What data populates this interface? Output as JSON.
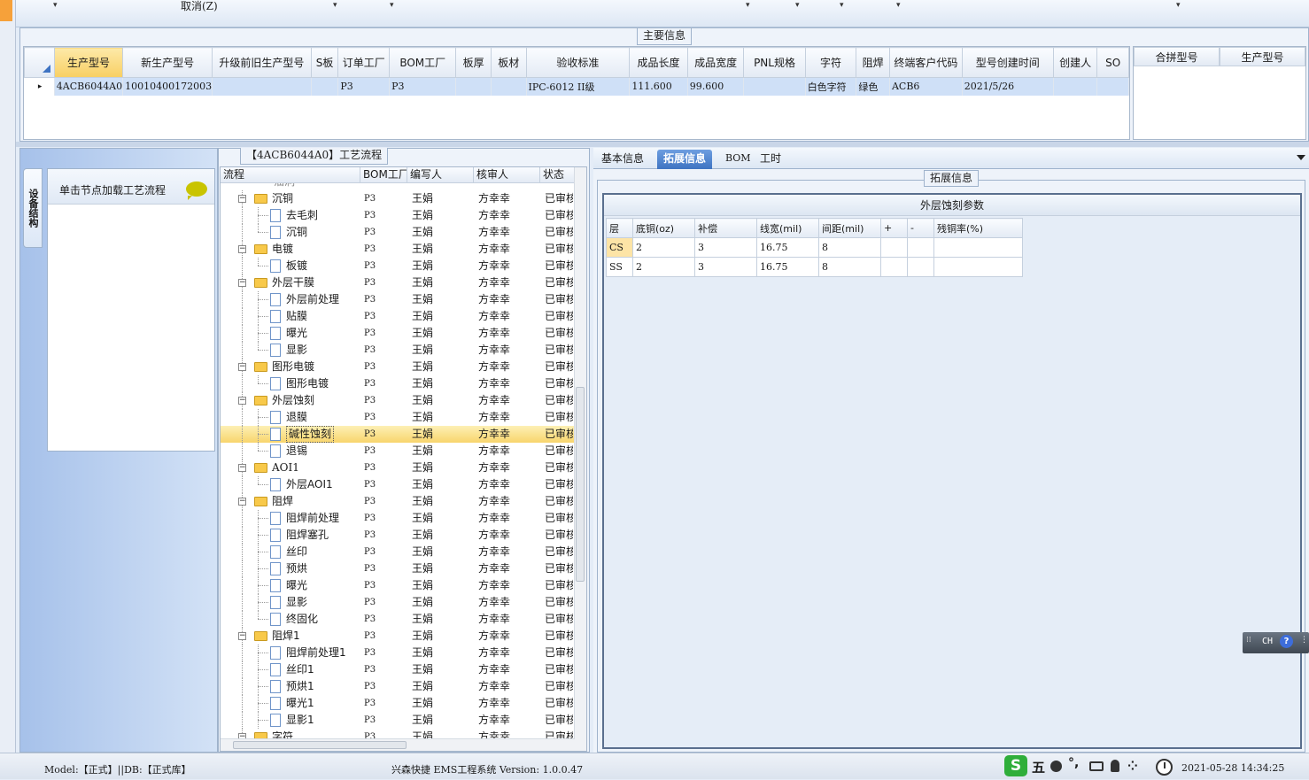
{
  "toolbar": {
    "cancel_label": "取消(Z)",
    "dropdown_glyph": "▾"
  },
  "main_info": {
    "title": "主要信息",
    "columns": [
      "生产型号",
      "新生产型号",
      "升级前旧生产型号",
      "S板",
      "订单工厂",
      "BOM工厂",
      "板厚",
      "板材",
      "验收标准",
      "成品长度",
      "成品宽度",
      "PNL规格",
      "字符",
      "阻焊",
      "终端客户代码",
      "型号创建时间",
      "创建人",
      "SO"
    ],
    "row": [
      "4ACB6044A0",
      "10010400172003",
      "",
      "",
      "P3",
      "P3",
      "",
      "",
      "IPC-6012 II级",
      "111.600",
      "99.600",
      "",
      "白色字符",
      "绿色",
      "ACB6",
      "2021/5/26",
      "",
      ""
    ],
    "row_indicator": "▸",
    "merge_columns": [
      "合拼型号",
      "生产型号"
    ]
  },
  "left_nav": {
    "vertical_tab": "设备结构",
    "panel_title": "单击节点加载工艺流程"
  },
  "flow": {
    "title": "【4ACB6044A0】工艺流程",
    "columns": [
      "流程",
      "BOM工厂",
      "编写人",
      "核审人",
      "状态"
    ],
    "top_partial": "油洞",
    "rows": [
      {
        "level": 0,
        "label": "沉铜",
        "bom": "P3",
        "writer": "王娟",
        "reviewer": "方幸幸",
        "status": "已审核",
        "open": true
      },
      {
        "level": 1,
        "label": "去毛刺",
        "bom": "P3",
        "writer": "王娟",
        "reviewer": "方幸幸",
        "status": "已审核"
      },
      {
        "level": 1,
        "label": "沉铜",
        "bom": "P3",
        "writer": "王娟",
        "reviewer": "方幸幸",
        "status": "已审核",
        "last": true
      },
      {
        "level": 0,
        "label": "电镀",
        "bom": "P3",
        "writer": "王娟",
        "reviewer": "方幸幸",
        "status": "已审核",
        "open": true
      },
      {
        "level": 1,
        "label": "板镀",
        "bom": "P3",
        "writer": "王娟",
        "reviewer": "方幸幸",
        "status": "已审核",
        "last": true
      },
      {
        "level": 0,
        "label": "外层干膜",
        "bom": "P3",
        "writer": "王娟",
        "reviewer": "方幸幸",
        "status": "已审核",
        "open": true
      },
      {
        "level": 1,
        "label": "外层前处理",
        "bom": "P3",
        "writer": "王娟",
        "reviewer": "方幸幸",
        "status": "已审核"
      },
      {
        "level": 1,
        "label": "贴膜",
        "bom": "P3",
        "writer": "王娟",
        "reviewer": "方幸幸",
        "status": "已审核"
      },
      {
        "level": 1,
        "label": "曝光",
        "bom": "P3",
        "writer": "王娟",
        "reviewer": "方幸幸",
        "status": "已审核"
      },
      {
        "level": 1,
        "label": "显影",
        "bom": "P3",
        "writer": "王娟",
        "reviewer": "方幸幸",
        "status": "已审核",
        "last": true
      },
      {
        "level": 0,
        "label": "图形电镀",
        "bom": "P3",
        "writer": "王娟",
        "reviewer": "方幸幸",
        "status": "已审核",
        "open": true
      },
      {
        "level": 1,
        "label": "图形电镀",
        "bom": "P3",
        "writer": "王娟",
        "reviewer": "方幸幸",
        "status": "已审核",
        "last": true
      },
      {
        "level": 0,
        "label": "外层蚀刻",
        "bom": "P3",
        "writer": "王娟",
        "reviewer": "方幸幸",
        "status": "已审核",
        "open": true
      },
      {
        "level": 1,
        "label": "退膜",
        "bom": "P3",
        "writer": "王娟",
        "reviewer": "方幸幸",
        "status": "已审核"
      },
      {
        "level": 1,
        "label": "碱性蚀刻",
        "bom": "P3",
        "writer": "王娟",
        "reviewer": "方幸幸",
        "status": "已审核",
        "selected": true
      },
      {
        "level": 1,
        "label": "退锡",
        "bom": "P3",
        "writer": "王娟",
        "reviewer": "方幸幸",
        "status": "已审核",
        "last": true
      },
      {
        "level": 0,
        "label": "AOI1",
        "bom": "P3",
        "writer": "王娟",
        "reviewer": "方幸幸",
        "status": "已审核",
        "open": true
      },
      {
        "level": 1,
        "label": "外层AOI1",
        "bom": "P3",
        "writer": "王娟",
        "reviewer": "方幸幸",
        "status": "已审核",
        "last": true
      },
      {
        "level": 0,
        "label": "阻焊",
        "bom": "P3",
        "writer": "王娟",
        "reviewer": "方幸幸",
        "status": "已审核",
        "open": true
      },
      {
        "level": 1,
        "label": "阻焊前处理",
        "bom": "P3",
        "writer": "王娟",
        "reviewer": "方幸幸",
        "status": "已审核"
      },
      {
        "level": 1,
        "label": "阻焊塞孔",
        "bom": "P3",
        "writer": "王娟",
        "reviewer": "方幸幸",
        "status": "已审核"
      },
      {
        "level": 1,
        "label": "丝印",
        "bom": "P3",
        "writer": "王娟",
        "reviewer": "方幸幸",
        "status": "已审核"
      },
      {
        "level": 1,
        "label": "预烘",
        "bom": "P3",
        "writer": "王娟",
        "reviewer": "方幸幸",
        "status": "已审核"
      },
      {
        "level": 1,
        "label": "曝光",
        "bom": "P3",
        "writer": "王娟",
        "reviewer": "方幸幸",
        "status": "已审核"
      },
      {
        "level": 1,
        "label": "显影",
        "bom": "P3",
        "writer": "王娟",
        "reviewer": "方幸幸",
        "status": "已审核"
      },
      {
        "level": 1,
        "label": "终固化",
        "bom": "P3",
        "writer": "王娟",
        "reviewer": "方幸幸",
        "status": "已审核",
        "last": true
      },
      {
        "level": 0,
        "label": "阻焊1",
        "bom": "P3",
        "writer": "王娟",
        "reviewer": "方幸幸",
        "status": "已审核",
        "open": true
      },
      {
        "level": 1,
        "label": "阻焊前处理1",
        "bom": "P3",
        "writer": "王娟",
        "reviewer": "方幸幸",
        "status": "已审核"
      },
      {
        "level": 1,
        "label": "丝印1",
        "bom": "P3",
        "writer": "王娟",
        "reviewer": "方幸幸",
        "status": "已审核"
      },
      {
        "level": 1,
        "label": "预烘1",
        "bom": "P3",
        "writer": "王娟",
        "reviewer": "方幸幸",
        "status": "已审核"
      },
      {
        "level": 1,
        "label": "曝光1",
        "bom": "P3",
        "writer": "王娟",
        "reviewer": "方幸幸",
        "status": "已审核"
      },
      {
        "level": 1,
        "label": "显影1",
        "bom": "P3",
        "writer": "王娟",
        "reviewer": "方幸幸",
        "status": "已审核"
      },
      {
        "level": 0,
        "label": "字符",
        "bom": "P3",
        "writer": "王娟",
        "reviewer": "方幸幸",
        "status": "已审核",
        "open": true
      }
    ]
  },
  "right": {
    "tabs": [
      "基本信息",
      "拓展信息",
      "BOM",
      "工时"
    ],
    "active_tab": "拓展信息",
    "ext_title": "拓展信息",
    "etch": {
      "title": "外层蚀刻参数",
      "columns": [
        "层",
        "底铜(oz)",
        "补偿",
        "线宽(mil)",
        "间距(mil)",
        "+",
        "-",
        "残铜率(%)"
      ],
      "rows": [
        [
          "CS",
          "2",
          "3",
          "16.75",
          "8",
          "",
          "",
          ""
        ],
        [
          "SS",
          "2",
          "3",
          "16.75",
          "8",
          "",
          "",
          ""
        ]
      ]
    }
  },
  "ime": {
    "lang": "CH",
    "help": "?"
  },
  "status": {
    "model": "Model:【正式】||DB:【正式库】",
    "app": "兴森快捷 EMS工程系统 Version: 1.0.0.47",
    "ime_mode": "五",
    "datetime": "2021-05-28 14:34:25"
  },
  "colors": {
    "accent": "#3e73c2",
    "selected_row": "#f8d56c",
    "header_sel": "#f8cf63"
  }
}
